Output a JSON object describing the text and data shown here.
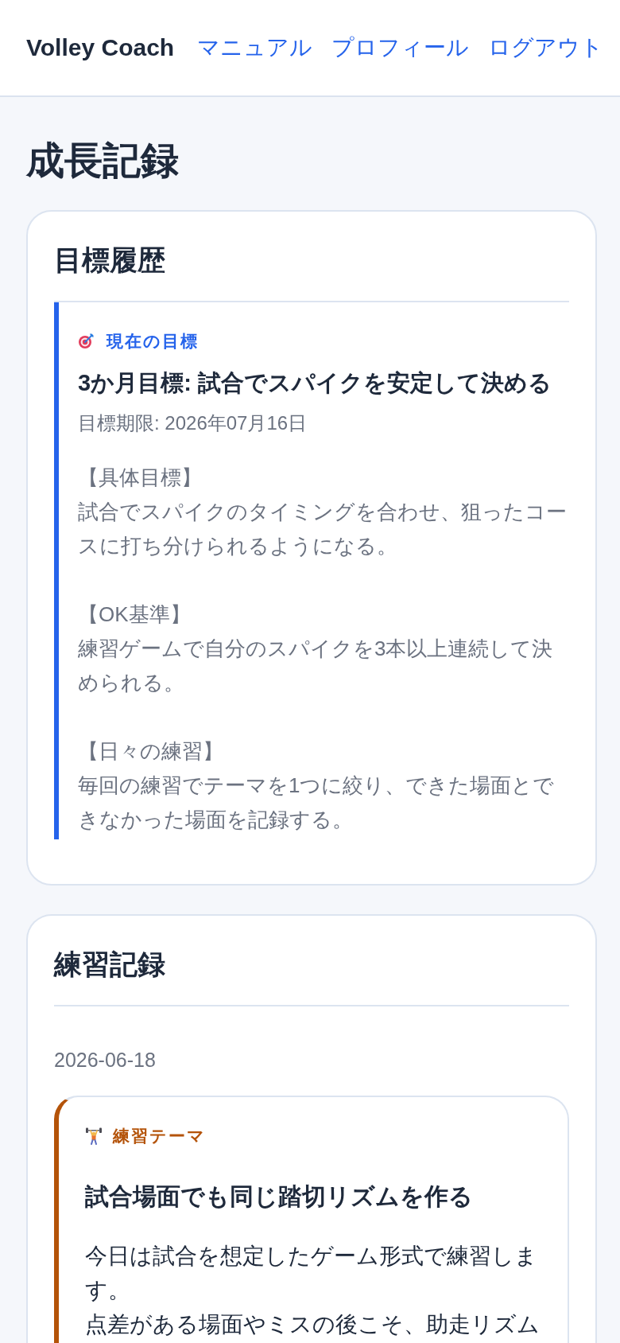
{
  "header": {
    "brand": "Volley Coach",
    "nav": [
      {
        "label": "マニュアル"
      },
      {
        "label": "プロフィール"
      },
      {
        "label": "ログアウト"
      }
    ]
  },
  "page_title": "成長記録",
  "goal_history": {
    "title": "目標履歴",
    "goals": [
      {
        "badge": "現在の目標",
        "title": "3か月目標: 試合でスパイクを安定して決める",
        "deadline": "目標期限: 2026年07月16日",
        "sections": [
          {
            "heading": "【具体目標】",
            "text": "試合でスパイクのタイミングを合わせ、狙ったコースに打ち分けられるようになる。"
          },
          {
            "heading": "【OK基準】",
            "text": "練習ゲームで自分のスパイクを3本以上連続して決められる。"
          },
          {
            "heading": "【日々の練習】",
            "text": "毎回の練習でテーマを1つに絞り、できた場面とできなかった場面を記録する。"
          }
        ]
      }
    ]
  },
  "practice_log": {
    "title": "練習記録",
    "entries": [
      {
        "date": "2026-06-18",
        "cards": [
          {
            "label": "練習テーマ",
            "title": "試合場面でも同じ踏切リズムを作る",
            "paragraphs": [
              "今日は試合を想定したゲーム形式で練習します。",
              "点差がある場面やミスの後こそ、助走リズム"
            ]
          }
        ]
      }
    ]
  }
}
